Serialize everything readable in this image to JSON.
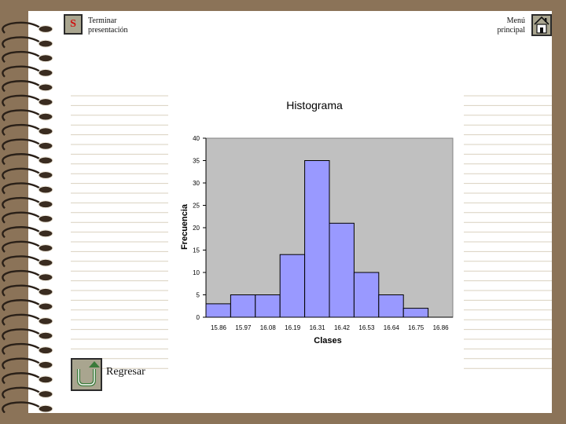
{
  "nav": {
    "stop_symbol": "S",
    "stop_label_1": "Terminar",
    "stop_label_2": "presentación",
    "menu_label_1": "Menú",
    "menu_label_2": "principal",
    "back_label": "Regresar"
  },
  "icons": {
    "stop": "stop-sign-icon",
    "home": "home-icon",
    "back": "u-turn-arrow-icon"
  },
  "colors": {
    "background": "#8b7358",
    "bar_fill": "#9999ff",
    "plot_area": "#c0c0c0",
    "button_face": "#a9a58f",
    "back_arrow": "#3a7a3a"
  },
  "chart_data": {
    "type": "bar",
    "title": "Histograma",
    "xlabel": "Clases",
    "ylabel": "Frecuencia",
    "ylim": [
      0,
      40
    ],
    "yticks": [
      0,
      5,
      10,
      15,
      20,
      25,
      30,
      35,
      40
    ],
    "categories": [
      "15.86",
      "15.97",
      "16.08",
      "16.19",
      "16.31",
      "16.42",
      "16.53",
      "16.64",
      "16.75",
      "16.86"
    ],
    "values": [
      3,
      5,
      5,
      14,
      35,
      21,
      10,
      5,
      2,
      0
    ],
    "grid": false
  }
}
